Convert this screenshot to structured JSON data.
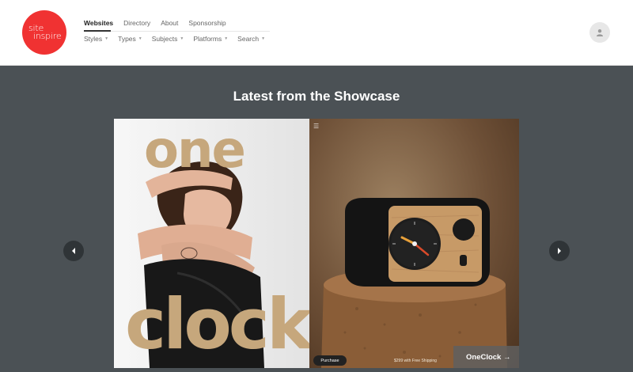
{
  "logo": {
    "line1": "site",
    "line2": "inspire",
    "color": "#f03232"
  },
  "nav": {
    "primary": [
      "Websites",
      "Directory",
      "About",
      "Sponsorship"
    ],
    "active": "Websites",
    "secondary": [
      "Styles",
      "Types",
      "Subjects",
      "Platforms",
      "Search"
    ]
  },
  "user": {
    "icon": "user-icon"
  },
  "main": {
    "heading": "Latest from the Showcase",
    "slide": {
      "word_top": "one",
      "word_bottom": "clock",
      "purchase_label": "Purchase",
      "price_text": "$299 with Free Shipping",
      "caption": "OneClock →"
    },
    "prev_icon": "chevron-left-icon",
    "next_icon": "chevron-right-icon"
  },
  "colors": {
    "background": "#4b5155",
    "accent_gold": "#c6a77c"
  }
}
